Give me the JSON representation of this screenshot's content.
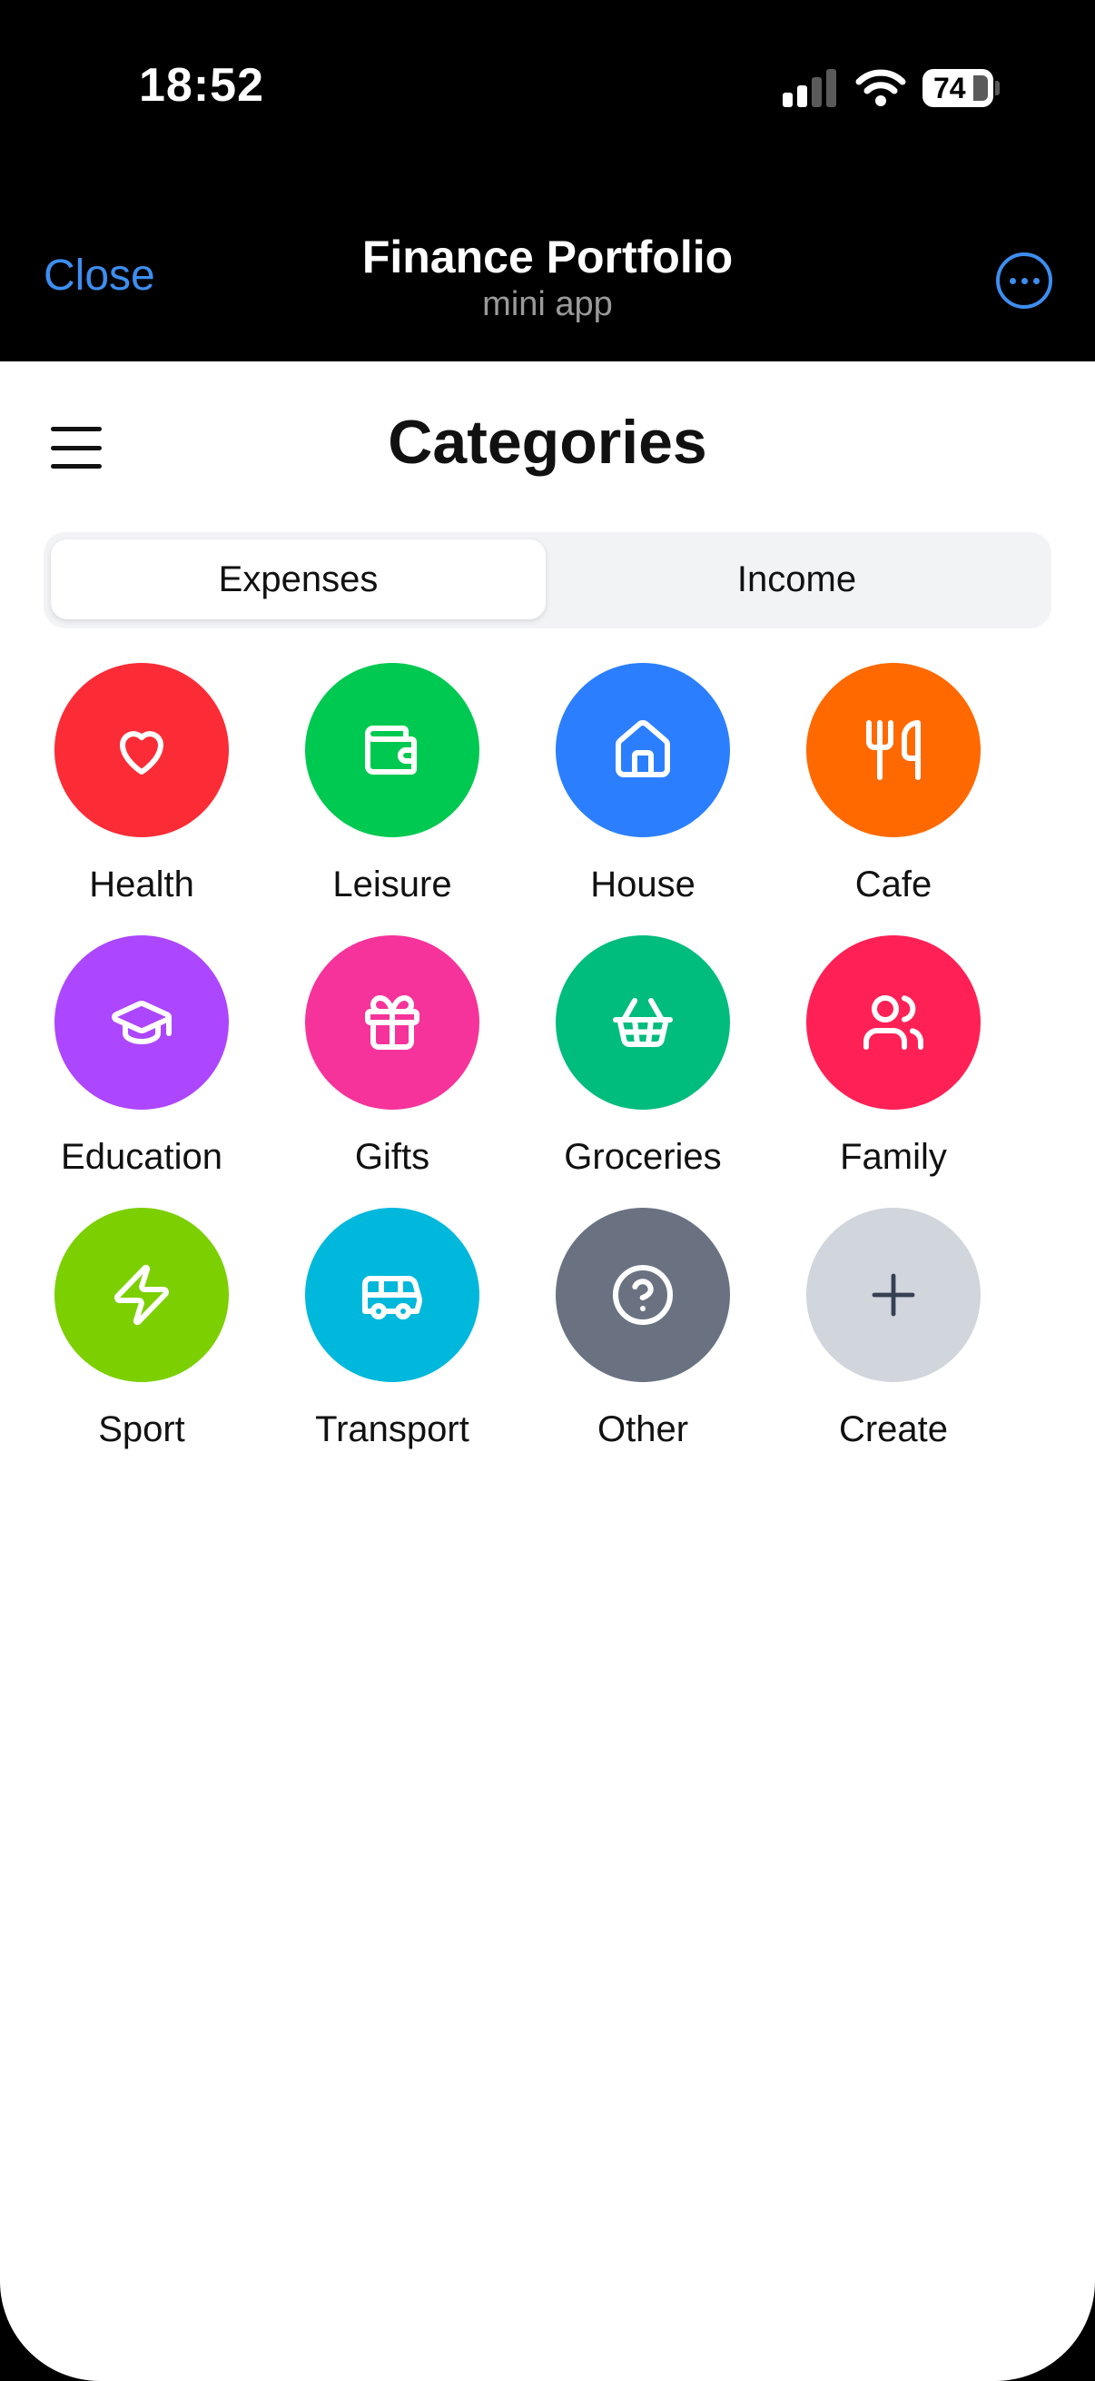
{
  "status_bar": {
    "time": "18:52",
    "battery": "74"
  },
  "nav": {
    "close_label": "Close",
    "title": "Finance Portfolio",
    "subtitle": "mini app"
  },
  "page": {
    "title": "Categories"
  },
  "tabs": [
    {
      "label": "Expenses",
      "active": true
    },
    {
      "label": "Income",
      "active": false
    }
  ],
  "categories": [
    {
      "label": "Health",
      "icon": "heart-icon",
      "color": "#fb2c36"
    },
    {
      "label": "Leisure",
      "icon": "wallet-icon",
      "color": "#00c951"
    },
    {
      "label": "House",
      "icon": "house-icon",
      "color": "#2b7fff"
    },
    {
      "label": "Cafe",
      "icon": "utensils-icon",
      "color": "#ff6900"
    },
    {
      "label": "Education",
      "icon": "graduation-cap-icon",
      "color": "#ad46ff"
    },
    {
      "label": "Gifts",
      "icon": "gift-icon",
      "color": "#f6339a"
    },
    {
      "label": "Groceries",
      "icon": "shopping-basket-icon",
      "color": "#00bc7d"
    },
    {
      "label": "Family",
      "icon": "users-icon",
      "color": "#ff2056"
    },
    {
      "label": "Sport",
      "icon": "zap-icon",
      "color": "#7ccf00"
    },
    {
      "label": "Transport",
      "icon": "bus-icon",
      "color": "#00b8db"
    },
    {
      "label": "Other",
      "icon": "question-circle-icon",
      "color": "#6a7282"
    },
    {
      "label": "Create",
      "icon": "plus-icon",
      "color": "#d1d5dc"
    }
  ]
}
